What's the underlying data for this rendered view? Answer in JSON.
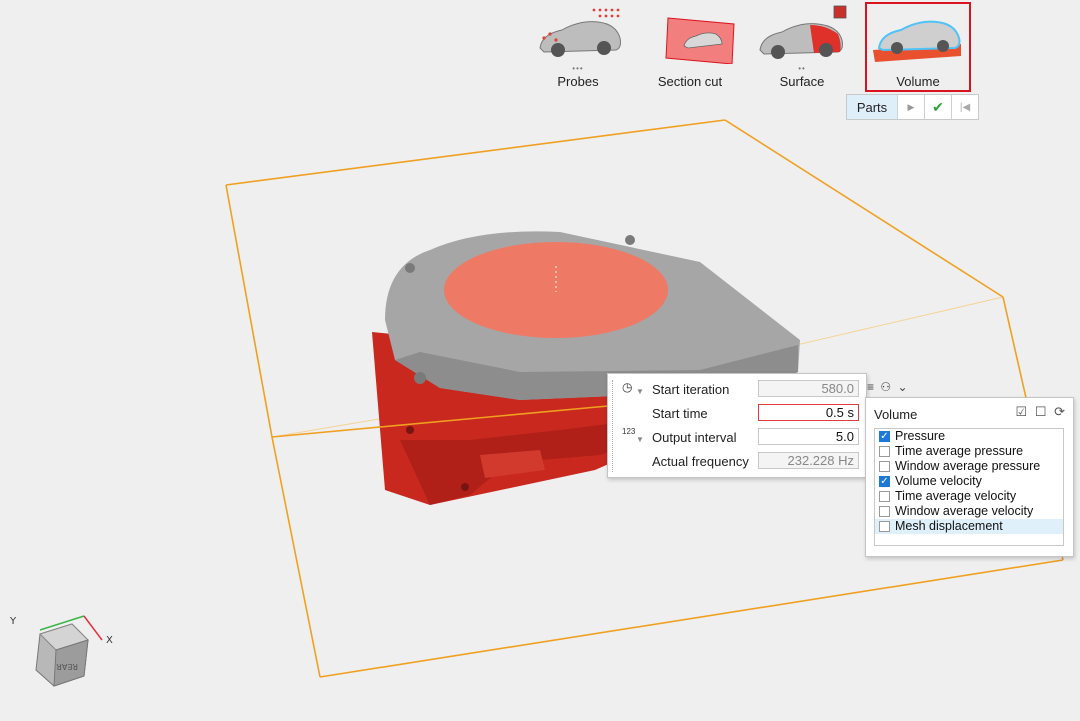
{
  "toolbar": {
    "tools": [
      {
        "label": "Probes",
        "dots": "•••"
      },
      {
        "label": "Section cut",
        "dots": ""
      },
      {
        "label": "Surface",
        "dots": "••"
      },
      {
        "label": "Volume",
        "dots": "",
        "selected": true
      }
    ],
    "subbar": {
      "parts_label": "Parts"
    }
  },
  "params": {
    "start_iteration": {
      "label": "Start iteration",
      "value": "580.0"
    },
    "start_time": {
      "label": "Start time",
      "value": "0.5 s"
    },
    "output_interval": {
      "label": "Output interval",
      "value": "5.0",
      "icon_text": "123"
    },
    "actual_frequency": {
      "label": "Actual frequency",
      "value": "232.228 Hz"
    }
  },
  "volume_panel": {
    "title": "Volume",
    "items": [
      {
        "label": "Pressure",
        "checked": true
      },
      {
        "label": "Time average pressure",
        "checked": false
      },
      {
        "label": "Window average pressure",
        "checked": false
      },
      {
        "label": "Volume velocity",
        "checked": true
      },
      {
        "label": "Time average velocity",
        "checked": false
      },
      {
        "label": "Window average velocity",
        "checked": false
      },
      {
        "label": "Mesh displacement",
        "checked": false,
        "highlighted": true
      }
    ]
  },
  "axes": {
    "x": "X",
    "y": "Y",
    "cube_face": "REAR"
  },
  "colors": {
    "accent_red": "#d9141e",
    "box_orange": "#f0a020",
    "part_red": "#c8281e",
    "part_grey": "#9a9a9a",
    "check_blue": "#1e79d6"
  }
}
